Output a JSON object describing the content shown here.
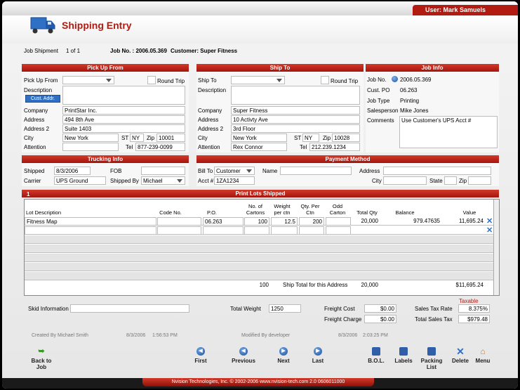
{
  "header": {
    "user": "User: Mark Samuels",
    "title": "Shipping Entry"
  },
  "jobline": {
    "job_shipment_label": "Job Shipment",
    "job_shipment_value": "1 of 1",
    "job_no": "Job No. : 2006.05.369",
    "customer": "Customer: Super Fitness"
  },
  "pickup": {
    "heading": "Pick Up From",
    "pickup_label": "Pick Up From",
    "pickup_value": "",
    "round_trip": "Round Trip",
    "description": "Description",
    "cust_addr": "Cust. Addr.",
    "company_label": "Company",
    "company": "PrintStar Inc.",
    "address_label": "Address",
    "address": "494 8th Ave",
    "address2_label": "Address 2",
    "address2": "Suite 1403",
    "city_label": "City",
    "city": "New York",
    "st_label": "ST",
    "st": "NY",
    "zip_label": "Zip",
    "zip": "10001",
    "attention_label": "Attention",
    "attention": "",
    "tel_label": "Tel",
    "tel": "877-239-0099"
  },
  "shipto": {
    "heading": "Ship To",
    "shipto_label": "Ship To",
    "shipto_value": "",
    "round_trip": "Round Trip",
    "description": "Description",
    "company_label": "Company",
    "company": "Super Fitness",
    "address_label": "Address",
    "address": "10 Activty Ave",
    "address2_label": "Address 2",
    "address2": "3rd Floor",
    "city_label": "City",
    "city": "New York",
    "st_label": "ST",
    "st": "NY",
    "zip_label": "Zip",
    "zip": "10028",
    "attention_label": "Attention",
    "attention": "Rex Connor",
    "tel_label": "Tel",
    "tel": "212.239.1234"
  },
  "jobinfo": {
    "heading": "Job Info",
    "jobno_label": "Job No.",
    "jobno": "2006.05.369",
    "custpo_label": "Cust. PO",
    "custpo": "06.263",
    "jobtype_label": "Job Type",
    "jobtype": "Printing",
    "salesperson_label": "Salesperson",
    "salesperson": "Mike Jones",
    "comments_label": "Comments",
    "comments": "Use Customer's UPS Acct #"
  },
  "trucking": {
    "heading": "Trucking Info",
    "shipped_label": "Shipped",
    "shipped": "8/3/2006",
    "fob_label": "FOB",
    "fob": "",
    "carrier_label": "Carrier",
    "carrier": "UPS Ground",
    "shippedby_label": "Shipped By",
    "shippedby": "Michael"
  },
  "payment": {
    "heading": "Payment Method",
    "billto_label": "Bill To",
    "billto": "Customer",
    "name_label": "Name",
    "name": "",
    "address_label": "Address",
    "address": "",
    "acct_label": "Acct #",
    "acct": "1ZA1234",
    "city_label": "City",
    "city": "",
    "state_label": "State",
    "state": "",
    "zip_label": "Zip",
    "zip": ""
  },
  "lots": {
    "heading": "Print Lots Shipped",
    "index": "1",
    "columns": {
      "desc": "Lot Description",
      "code": "Code No.",
      "po": "P.O.",
      "cartons": "No. of Cartons",
      "weight": "Weight per ctn",
      "qty": "Qty. Per Ctn",
      "odd": "Odd Carton",
      "total": "Total Qty",
      "balance": "Balance",
      "value": "Value"
    },
    "row1": {
      "desc": "Fitness Map",
      "code": "",
      "po": "06.263",
      "cartons": "100",
      "weight": "12.5",
      "qty": "200",
      "odd": "",
      "total": "20,000",
      "balance": "979.47635",
      "value": "11,695.24"
    },
    "totals": {
      "cartons": "100",
      "label": "Ship Total for this Address",
      "qty": "20,000",
      "value": "$11,695.24"
    }
  },
  "summary": {
    "skid_label": "Skid Information",
    "skid": "",
    "weight_label": "Total Weight",
    "weight": "1250",
    "freight_cost_label": "Freight Cost",
    "freight_cost": "$0.00",
    "freight_charge_label": "Freight Charge",
    "freight_charge": "$0.00",
    "taxable": "Taxable",
    "tax_rate_label": "Sales Tax Rate",
    "tax_rate": "8.375%",
    "tax_total_label": "Total Sales Tax",
    "tax_total": "$979.48"
  },
  "meta": {
    "created": "Created By Michael Smith",
    "created_date": "8/3/2006",
    "created_time": "1:56:53 PM",
    "modified": "Modified By developer",
    "modified_date": "8/3/2006",
    "modified_time": "2:03:25 PM"
  },
  "nav": {
    "back": "Back to Job",
    "first": "First",
    "previous": "Previous",
    "next": "Next",
    "last": "Last",
    "bol": "B.O.L.",
    "labels": "Labels",
    "packing": "Packing List",
    "delete": "Delete",
    "menu": "Menu"
  },
  "footer": {
    "copyright": "Nvision Technologies, Inc. © 2002-2006 www.nvision-tech.com 2.0 0606011000"
  }
}
